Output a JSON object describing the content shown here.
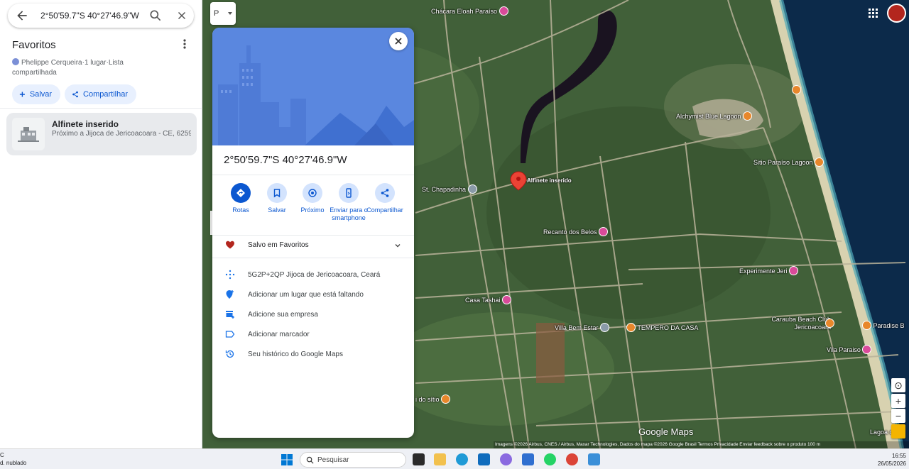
{
  "search": {
    "query": "2°50'59.7\"S 40°27'46.9\"W"
  },
  "list": {
    "title": "Favoritos",
    "owner": "Phelippe Cerqueira·1 lugar·Lista compartilhada",
    "save_label": "Salvar",
    "share_label": "Compartilhar",
    "items": [
      {
        "title": "Alfinete inserido",
        "subtitle": "Próximo a Jijoca de Jericoacoara - CE, 6259"
      }
    ]
  },
  "card": {
    "coords": "2°50'59.7\"S 40°27'46.9\"W",
    "actions": [
      {
        "label": "Rotas",
        "icon": "directions-icon"
      },
      {
        "label": "Salvar",
        "icon": "bookmark-icon"
      },
      {
        "label": "Próximo",
        "icon": "nearby-icon"
      },
      {
        "label": "Enviar para o smartphone",
        "icon": "phone-icon"
      },
      {
        "label": "Compartilhar",
        "icon": "share-icon"
      }
    ],
    "saved_label": "Salvo em Favoritos",
    "rows": [
      {
        "text": "5G2P+2QP Jijoca de Jericoacoara, Ceará",
        "icon": "plus-code-icon"
      },
      {
        "text": "Adicionar um lugar que está faltando",
        "icon": "add-location-icon"
      },
      {
        "text": "Adicione sua empresa",
        "icon": "add-business-icon"
      },
      {
        "text": "Adicionar marcador",
        "icon": "label-icon"
      },
      {
        "text": "Seu histórico do Google Maps",
        "icon": "history-icon"
      }
    ]
  },
  "map": {
    "layer_label": "P",
    "pin_label": "Alfinete inserido",
    "pois": [
      {
        "name": "Chácara Eloah Paraíso",
        "color": "pink"
      },
      {
        "name": "Alchymist Blue Lagoon",
        "color": "orange"
      },
      {
        "name": "Sitio Paraíso Lagoon",
        "color": "orange"
      },
      {
        "name": "St. Chapadinha",
        "color": "grey"
      },
      {
        "name": "Recanto dos Belos",
        "color": "pink"
      },
      {
        "name": "Experimente Jeri",
        "color": "pink"
      },
      {
        "name": "Casa Tashai",
        "color": "pink"
      },
      {
        "name": "Villa Bem Estar",
        "color": "grey"
      },
      {
        "name": "TEMPERO DA CASA",
        "color": "orange"
      },
      {
        "name": "Carauba Beach Club Jericoacoara",
        "color": "orange"
      },
      {
        "name": "Paradise B",
        "color": "orange"
      },
      {
        "name": "Vila Paraiso",
        "color": "pink"
      },
      {
        "name": "i do sítio",
        "color": "orange"
      },
      {
        "name": "Lagoa do",
        "color": "none"
      }
    ],
    "attribution": "Imagens ©2026 Airbus, CNES / Airbus, Maxar Technologies, Dados do mapa ©2026 Google   Brasil   Termos   Privacidade   Enviar feedback sobre o produto   100 m",
    "logo": "Google Maps"
  },
  "taskbar": {
    "weather_line1": "C",
    "weather_line2": "d. nublado",
    "search_placeholder": "Pesquisar",
    "time": "16:55",
    "date": "26/05/2026"
  },
  "colors": {
    "accent": "#0b57d0",
    "accent_light": "#d3e3fd",
    "heart": "#b3261e",
    "hero": "#5a87df"
  }
}
